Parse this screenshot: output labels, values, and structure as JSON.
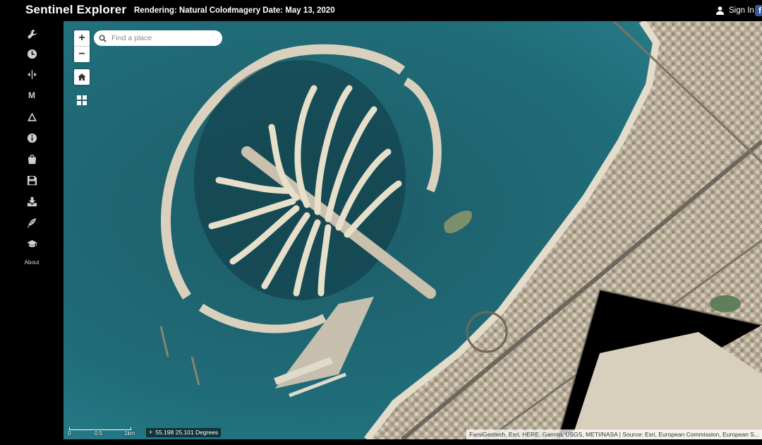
{
  "header": {
    "app_title": "Sentinel Explorer",
    "rendering": "Rendering: Natural Color",
    "imagery_date": "Imagery Date: May 13, 2020",
    "sign_in": "Sign In"
  },
  "sidebar": {
    "items": [
      {
        "icon": "wrench-icon"
      },
      {
        "icon": "clock-icon"
      },
      {
        "icon": "swipe-icon"
      },
      {
        "icon": "m-icon",
        "label": "M"
      },
      {
        "icon": "triangle-icon"
      },
      {
        "icon": "info-icon"
      },
      {
        "icon": "bookmark-bag-icon"
      },
      {
        "icon": "save-icon"
      },
      {
        "icon": "download-icon"
      },
      {
        "icon": "feather-icon"
      },
      {
        "icon": "graduation-cap-icon"
      }
    ],
    "about": "About"
  },
  "map": {
    "zoom_in": "+",
    "zoom_out": "−",
    "search_placeholder": "Find a place",
    "scale_labels": [
      "0",
      "0.5",
      "1km"
    ],
    "coordinates": "55.198 25.101 Degrees",
    "attribution": "FarsiGeotech, Esri, HERE, Garmin, USGS, METI/NASA | Source: Esri, European Commission, European S..."
  },
  "colors": {
    "sea": "#1f6d79",
    "deep_sea": "#133e4a",
    "land": "#b7ab97",
    "sand": "#d8d2c2"
  }
}
